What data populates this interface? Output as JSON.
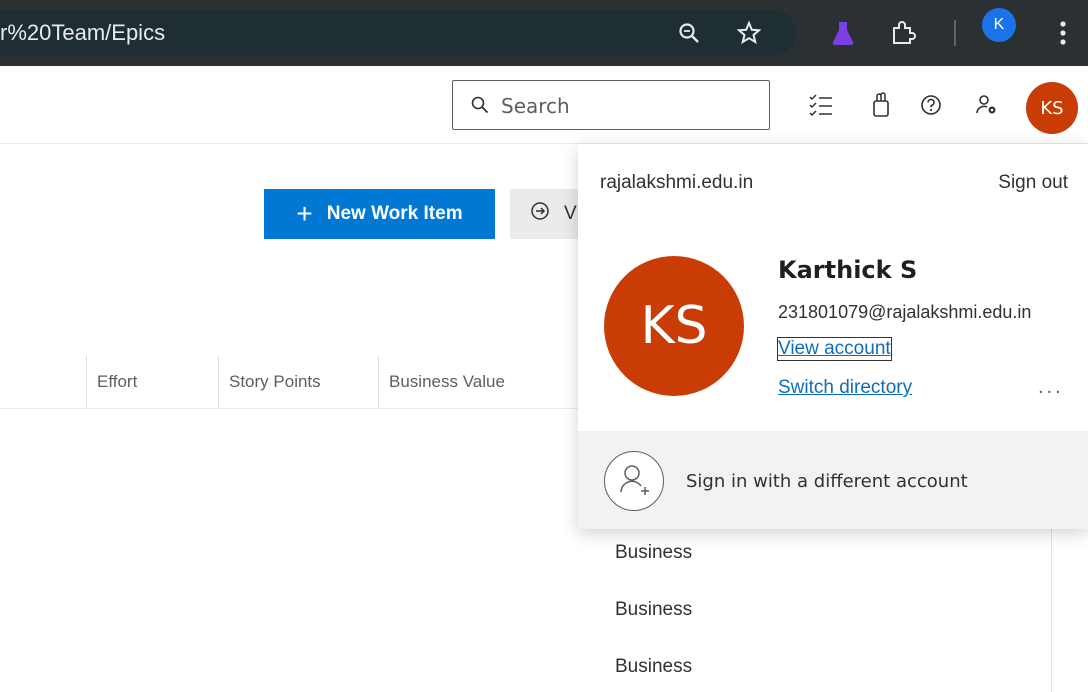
{
  "browser": {
    "url_fragment": "r%20Team/Epics",
    "profile_initial": "K",
    "icons": [
      "zoom-icon",
      "star-icon",
      "extension-lab-icon",
      "puzzle-icon",
      "menu-kebab-icon"
    ]
  },
  "header": {
    "search_placeholder": "Search",
    "icons": [
      "task-list-icon",
      "marketplace-bag-icon",
      "help-icon",
      "user-settings-icon"
    ],
    "avatar_initials": "KS"
  },
  "toolbar": {
    "new_work_item_label": "New Work Item",
    "view_label_partial": "V"
  },
  "table": {
    "columns": [
      "Effort",
      "Story Points",
      "Business Value"
    ],
    "rows": [
      "Business",
      "Business",
      "Business"
    ]
  },
  "account_flyout": {
    "tenant": "rajalakshmi.edu.in",
    "sign_out": "Sign out",
    "avatar_initials": "KS",
    "name": "Karthick S",
    "email": "231801079@rajalakshmi.edu.in",
    "view_account": "View account",
    "switch_directory": "Switch directory",
    "more": "...",
    "sign_in_different": "Sign in with a different account"
  },
  "colors": {
    "accent": "#0078d4",
    "avatar": "#ca3c06",
    "link": "#0f6cbd"
  }
}
